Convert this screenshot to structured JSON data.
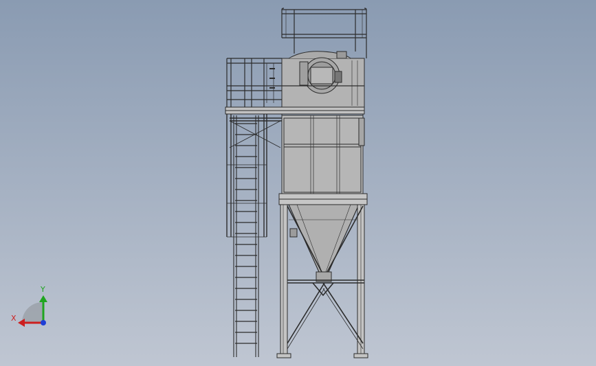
{
  "viewport": {
    "background_top": "#8a9bb2",
    "background_bottom": "#bfc6d2",
    "model_fill": "#b9b9b9",
    "model_shadow": "#8d8d8d",
    "model_edge": "#2b2b2b"
  },
  "triad": {
    "x_label": "X",
    "y_label": "Y",
    "x_color": "#cc1f1f",
    "y_color": "#1fa51f",
    "z_color": "#1f3fd6"
  }
}
